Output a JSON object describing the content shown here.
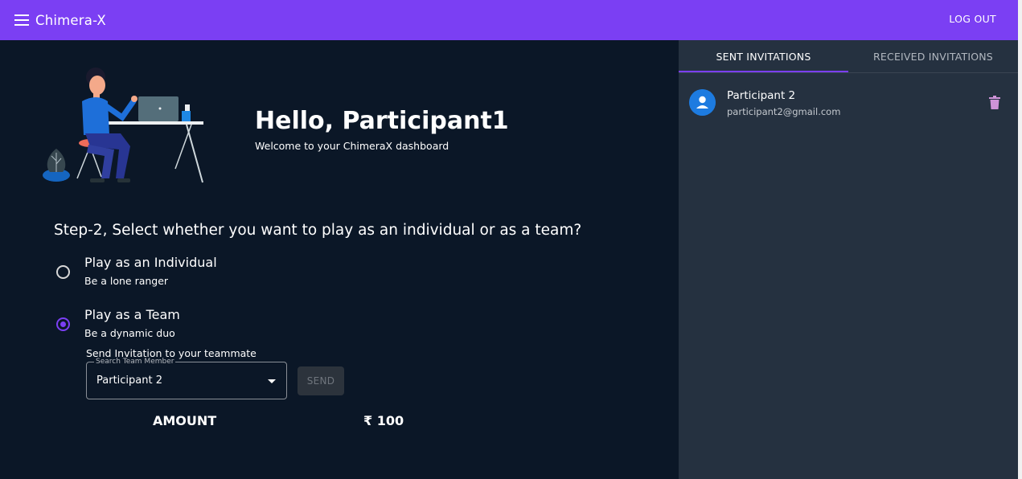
{
  "appbar": {
    "title": "Chimera-X",
    "logout_label": "LOG OUT",
    "color": "#7b3ff3"
  },
  "main": {
    "greeting": "Hello, Participant1",
    "welcome": "Welcome to your ChimeraX dashboard",
    "step_question": "Step-2, Select whether you want to play as an individual or as a team?",
    "options": [
      {
        "title": "Play as an Individual",
        "subtitle": "Be a lone ranger",
        "selected": false
      },
      {
        "title": "Play as a Team",
        "subtitle": "Be a dynamic duo",
        "selected": true
      }
    ],
    "send_invitation_label": "Send Invitation to your teammate",
    "search_field": {
      "label": "Search Team Member",
      "value": "Participant 2"
    },
    "send_button": "SEND",
    "amount_label": "AMOUNT",
    "amount_value": "₹ 100"
  },
  "sidebar": {
    "tabs": [
      {
        "label": "SENT INVITATIONS",
        "active": true
      },
      {
        "label": "RECEIVED INVITATIONS",
        "active": false
      }
    ],
    "invitations": [
      {
        "name": "Participant 2",
        "email": "participant2@gmail.com"
      }
    ]
  }
}
